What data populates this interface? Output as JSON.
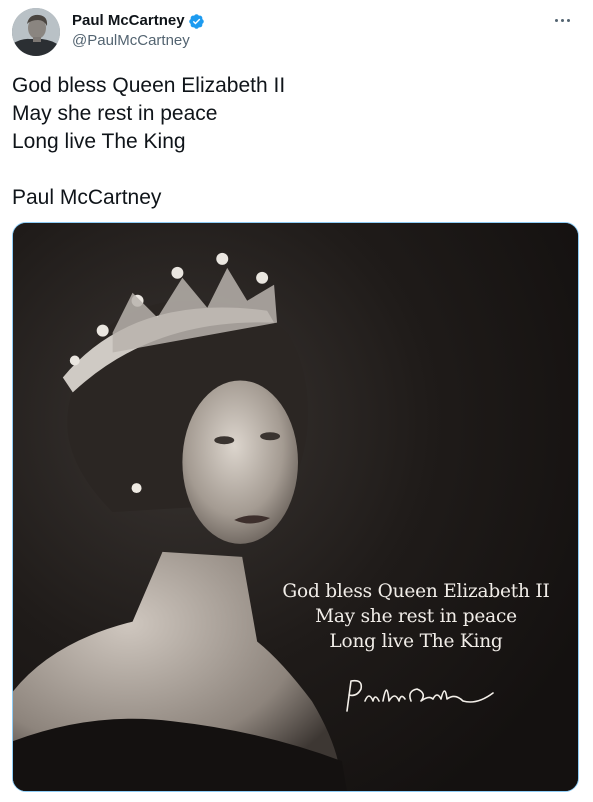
{
  "author": {
    "display_name": "Paul McCartney",
    "handle": "@PaulMcCartney",
    "verified_icon": "verified-badge-icon",
    "avatar_icon": "profile-avatar"
  },
  "menu": {
    "more_icon": "more-options-icon"
  },
  "tweet": {
    "lines": [
      "God bless Queen Elizabeth II",
      "May she rest in peace",
      "Long live The King"
    ],
    "signoff": "Paul McCartney"
  },
  "media": {
    "caption_lines": [
      "God bless Queen Elizabeth II",
      "May she rest in peace",
      "Long live The King"
    ],
    "signature_text": "Paul McCartney"
  },
  "colors": {
    "text_primary": "#0f1419",
    "text_secondary": "#536471",
    "verified_blue": "#1d9bf0",
    "media_border": "#8ecdf7",
    "media_background": "#1a1716"
  }
}
